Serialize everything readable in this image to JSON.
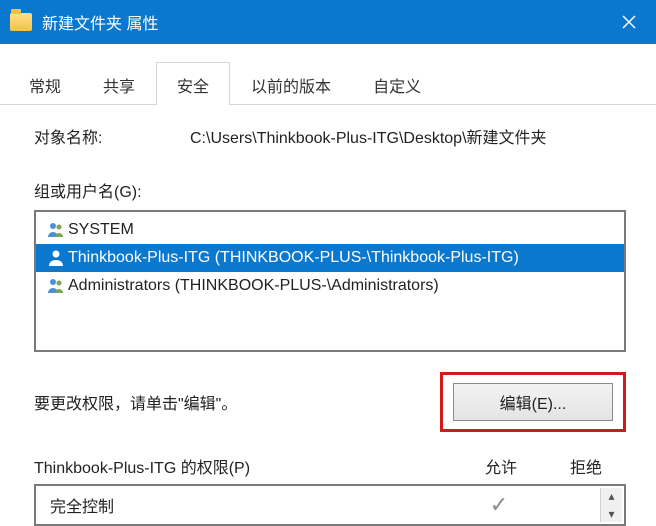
{
  "titlebar": {
    "title": "新建文件夹 属性"
  },
  "tabs": [
    {
      "label": "常规",
      "active": false
    },
    {
      "label": "共享",
      "active": false
    },
    {
      "label": "安全",
      "active": true
    },
    {
      "label": "以前的版本",
      "active": false
    },
    {
      "label": "自定义",
      "active": false
    }
  ],
  "object": {
    "label": "对象名称:",
    "path": "C:\\Users\\Thinkbook-Plus-ITG\\Desktop\\新建文件夹"
  },
  "groups": {
    "label": "组或用户名(G):",
    "items": [
      {
        "icon": "users-icon",
        "text": "SYSTEM",
        "selected": false
      },
      {
        "icon": "user-icon",
        "text": "Thinkbook-Plus-ITG (THINKBOOK-PLUS-\\Thinkbook-Plus-ITG)",
        "selected": true
      },
      {
        "icon": "users-icon",
        "text": "Administrators (THINKBOOK-PLUS-\\Administrators)",
        "selected": false
      }
    ]
  },
  "editSection": {
    "hint": "要更改权限，请单击\"编辑\"。",
    "button": "编辑(E)..."
  },
  "permissions": {
    "title": "Thinkbook-Plus-ITG 的权限(P)",
    "allowLabel": "允许",
    "denyLabel": "拒绝",
    "rows": [
      {
        "name": "完全控制",
        "allow": true,
        "deny": false
      }
    ]
  }
}
